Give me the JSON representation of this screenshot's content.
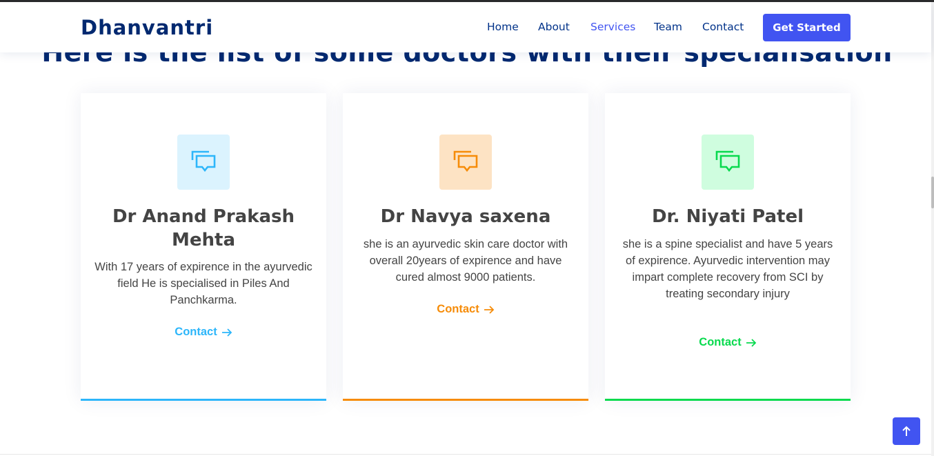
{
  "brand": {
    "name": "Dhanvantri",
    "primary_color": "#4154f1",
    "navy_color": "#012970"
  },
  "nav": {
    "items": [
      {
        "label": "Home",
        "active": false
      },
      {
        "label": "About",
        "active": false
      },
      {
        "label": "Services",
        "active": true
      },
      {
        "label": "Team",
        "active": false
      },
      {
        "label": "Contact",
        "active": false
      }
    ],
    "cta_label": "Get Started"
  },
  "section": {
    "title": "Here is the list of some doctors with their specialisation"
  },
  "cards": [
    {
      "icon": "chat-square-icon",
      "accent_color": "#2db6fa",
      "name": "Dr Anand Prakash Mehta",
      "description": "With 17 years of expirence in the ayurvedic field He is specialised in Piles And Panchkarma.",
      "link_label": "Contact"
    },
    {
      "icon": "chat-square-icon",
      "accent_color": "#f68c09",
      "name": "Dr Navya saxena",
      "description": "she is an ayurvedic skin care doctor with overall 20years of expirence and have cured almost 9000 patients.",
      "link_label": "Contact"
    },
    {
      "icon": "chat-square-icon",
      "accent_color": "#08da4e",
      "name": "Dr. Niyati Patel",
      "description": "she is a spine specialist and have 5 years of expirence. Ayurvedic intervention may impart complete recovery from SCI by treating secondary injury",
      "link_label": "Contact"
    }
  ],
  "back_to_top": {
    "icon": "arrow-up-icon"
  }
}
